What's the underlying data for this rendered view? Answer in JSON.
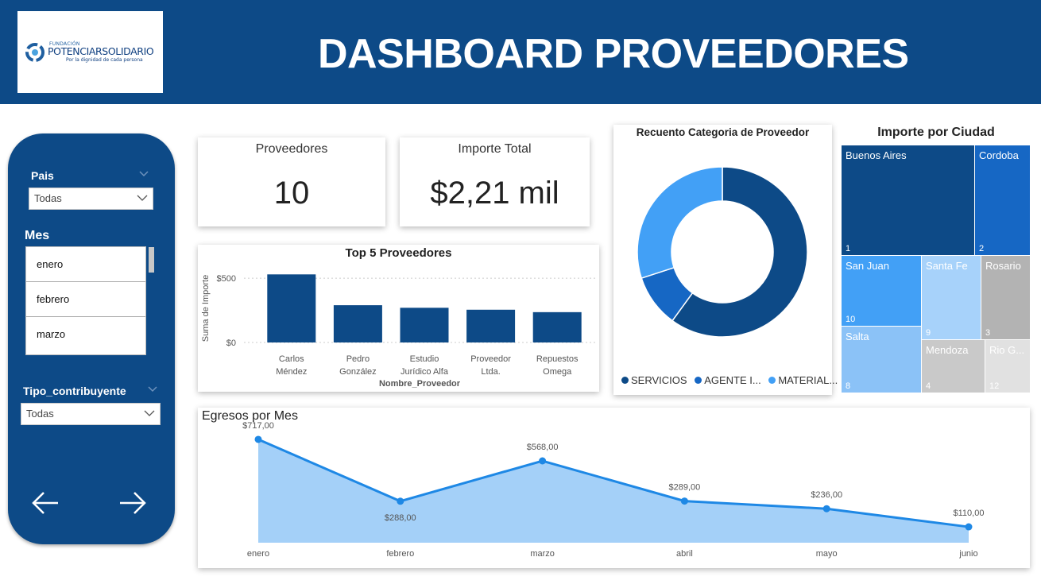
{
  "header": {
    "title": "DASHBOARD PROVEEDORES",
    "logo": {
      "small": "FUNDACIÓN",
      "main": "POTENCIARSOLIDARIO",
      "tagline": "Por la dignidad de cada persona"
    }
  },
  "filters": {
    "pais": {
      "label": "Pais",
      "value": "Todas"
    },
    "mes": {
      "label": "Mes",
      "items": [
        "enero",
        "febrero",
        "marzo"
      ]
    },
    "tipo": {
      "label": "Tipo_contribuyente",
      "value": "Todas"
    },
    "icons": [
      "arrow-left-icon",
      "arrow-right-icon"
    ]
  },
  "kpis": {
    "proveedores": {
      "label": "Proveedores",
      "value": "10"
    },
    "importe": {
      "label": "Importe Total",
      "value": "$2,21 mil"
    }
  },
  "colors": {
    "primary": "#0d4a87",
    "mid": "#1667c4",
    "light": "#42a0f6",
    "area": "#a4d0f8",
    "line": "#1e88e5"
  },
  "chart_data": [
    {
      "type": "bar",
      "title": "Top 5 Proveedores",
      "xlabel": "Nombre_Proveedor",
      "ylabel": "Suma de Importe",
      "categories": [
        [
          "Carlos",
          "Méndez"
        ],
        [
          "Pedro",
          "González"
        ],
        [
          "Estudio",
          "Jurídico Alfa"
        ],
        [
          "Proveedor",
          "Ltda."
        ],
        [
          "Repuestos",
          "Omega"
        ]
      ],
      "values": [
        530,
        290,
        270,
        255,
        236
      ],
      "yticks": [
        "$500",
        "$0"
      ],
      "ylim": [
        0,
        600
      ]
    },
    {
      "type": "pie",
      "title": "Recuento Categoria de Proveedor",
      "legend": [
        "SERVICIOS",
        "AGENTE I...",
        "MATERIAL..."
      ],
      "values": [
        6,
        1,
        3
      ],
      "colors": [
        "#0d4a87",
        "#1667c4",
        "#42a0f6"
      ]
    },
    {
      "type": "treemap",
      "title": "Importe por Ciudad",
      "cells": [
        {
          "name": "Buenos Aires",
          "count": "1",
          "color": "#0d4a87"
        },
        {
          "name": "Cordoba",
          "count": "2",
          "color": "#1667c4"
        },
        {
          "name": "San Juan",
          "count": "10",
          "color": "#42a0f6"
        },
        {
          "name": "Santa Fe",
          "count": "9",
          "color": "#a7d2fa"
        },
        {
          "name": "Rosario",
          "count": "3",
          "color": "#b3b3b3"
        },
        {
          "name": "Salta",
          "count": "8",
          "color": "#8bc2f7"
        },
        {
          "name": "Mendoza",
          "count": "4",
          "color": "#c9c9c9"
        },
        {
          "name": "Rio G...",
          "count": "12",
          "color": "#e1e1e1"
        }
      ]
    },
    {
      "type": "area",
      "title": "Egresos por Mes",
      "x": [
        "enero",
        "febrero",
        "marzo",
        "abril",
        "mayo",
        "junio"
      ],
      "values": [
        717,
        288,
        568,
        289,
        236,
        110
      ],
      "labels": [
        "$717,00",
        "$288,00",
        "$568,00",
        "$289,00",
        "$236,00",
        "$110,00"
      ],
      "ylim": [
        0,
        750
      ]
    }
  ]
}
